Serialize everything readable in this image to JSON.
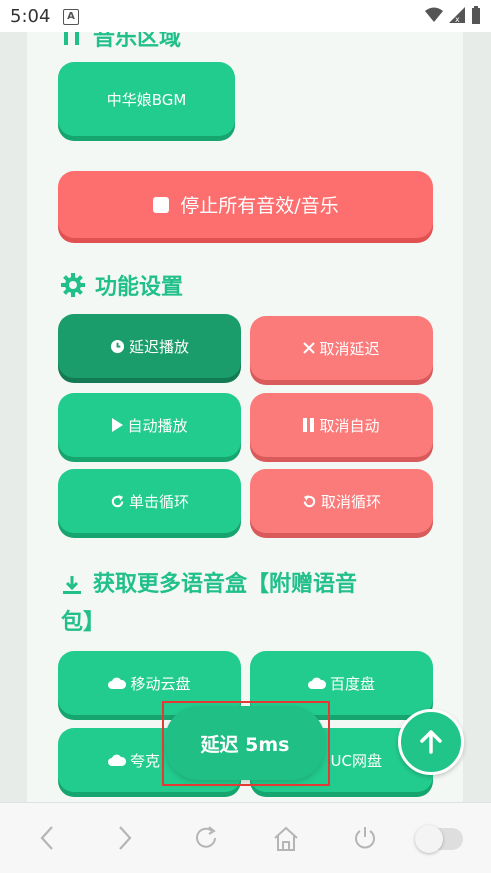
{
  "status_bar": {
    "time": "5:04",
    "notification_letter": "A"
  },
  "music_section": {
    "title": "音乐区域",
    "bgm_label": "中华娘BGM",
    "stop_all_label": "停止所有音效/音乐"
  },
  "function_section": {
    "title": "功能设置",
    "buttons": [
      {
        "label": "延迟播放",
        "icon": "clock-icon"
      },
      {
        "label": "取消延迟",
        "icon": "close-icon"
      },
      {
        "label": "自动播放",
        "icon": "play-icon"
      },
      {
        "label": "取消自动",
        "icon": "pause-icon"
      },
      {
        "label": "单击循环",
        "icon": "redo-icon"
      },
      {
        "label": "取消循环",
        "icon": "undo-icon"
      }
    ]
  },
  "download_section": {
    "title_line1": "获取更多语音盒【附赠语音",
    "title_line2": "包】",
    "buttons": [
      {
        "label": "移动云盘",
        "icon": "cloud-icon"
      },
      {
        "label": "百度盘",
        "icon": "cloud-icon"
      },
      {
        "label": "夸克",
        "icon": "cloud-icon"
      },
      {
        "label": "UC网盘",
        "icon": "cloud-icon"
      }
    ]
  },
  "toast": {
    "text": "延迟 5ms"
  },
  "colors": {
    "accent": "#22cc8e",
    "danger": "#fb7b7b",
    "title": "#21c08b"
  }
}
